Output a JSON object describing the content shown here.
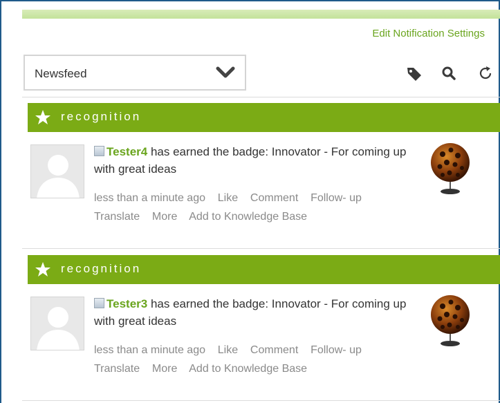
{
  "header": {
    "edit_notification_settings": "Edit Notification Settings"
  },
  "filter": {
    "selected": "Newsfeed"
  },
  "toolbar": {
    "icons": [
      "tag-icon",
      "search-icon",
      "refresh-icon"
    ]
  },
  "colors": {
    "accent_green": "#7bab15",
    "link_green": "#6aa51e",
    "meta_gray": "#8a8a8a"
  },
  "feed": [
    {
      "category": "recognition",
      "user": "Tester4",
      "text": " has earned the badge: Innovator - For coming up with great ideas",
      "time": "less than a minute ago",
      "actions": {
        "like": "Like",
        "comment": "Comment",
        "follow_a": "Follow-",
        "follow_b": "up",
        "translate": "Translate",
        "more": "More",
        "add_kb": "Add to Knowledge Base"
      }
    },
    {
      "category": "recognition",
      "user": "Tester3",
      "text": " has earned the badge: Innovator - For coming up with great ideas",
      "time": "less than a minute ago",
      "actions": {
        "like": "Like",
        "comment": "Comment",
        "follow_a": "Follow-",
        "follow_b": "up",
        "translate": "Translate",
        "more": "More",
        "add_kb": "Add to Knowledge Base"
      }
    }
  ]
}
